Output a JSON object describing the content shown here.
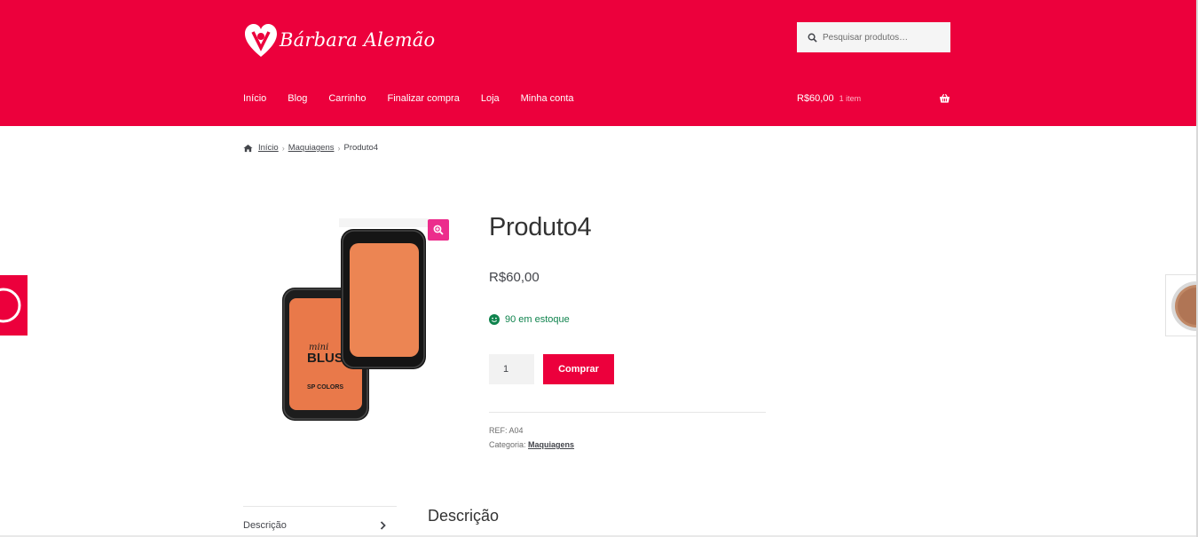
{
  "header": {
    "logo_text": "Bárbara Alemão",
    "search": {
      "placeholder": "Pesquisar produtos…"
    },
    "nav": [
      {
        "label": "Início"
      },
      {
        "label": "Blog"
      },
      {
        "label": "Carrinho"
      },
      {
        "label": "Finalizar compra"
      },
      {
        "label": "Loja"
      },
      {
        "label": "Minha conta"
      }
    ],
    "cart": {
      "amount": "R$60,00",
      "count": "1 item"
    }
  },
  "breadcrumb": {
    "home": "Início",
    "category": "Maquiagens",
    "current": "Produto4"
  },
  "product": {
    "image_text_line1": "mini",
    "image_text_line2": "BLUSH",
    "image_brand": "SP COLORS",
    "title": "Produto4",
    "price": "R$60,00",
    "stock": "90 em estoque",
    "quantity": "1",
    "buy_label": "Comprar",
    "ref_label": "REF:",
    "ref_value": "A04",
    "category_label": "Categoria:",
    "category_value": "Maquiagens"
  },
  "tabs": {
    "items": [
      {
        "label": "Descrição"
      }
    ],
    "active_heading": "Descrição"
  },
  "colors": {
    "brand": "#ec003c",
    "zoom": "#ec2d8c",
    "stock": "#0f834d"
  },
  "icons": [
    "search-icon",
    "cart-basket-icon",
    "home-icon",
    "zoom-icon",
    "smiley-icon",
    "chevron-right-icon"
  ]
}
